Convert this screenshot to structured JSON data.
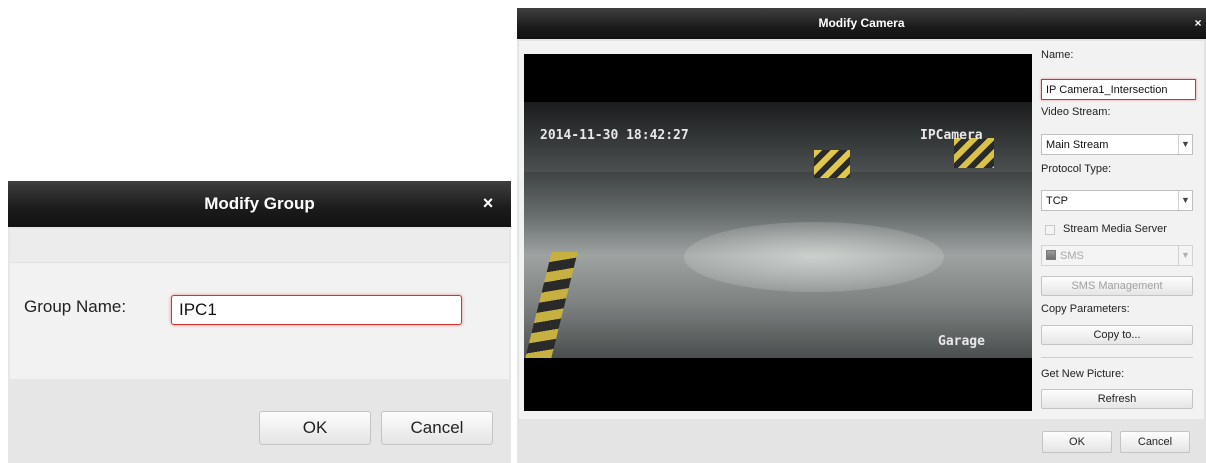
{
  "group_dialog": {
    "title": "Modify Group",
    "close_glyph": "×",
    "group_name_label": "Group Name:",
    "group_name_value": "IPC1",
    "ok_label": "OK",
    "cancel_label": "Cancel"
  },
  "camera_dialog": {
    "title": "Modify Camera",
    "close_glyph": "×",
    "preview": {
      "timestamp": "2014-11-30 18:42:27",
      "camera_osd": "IPCamera",
      "location_osd": "Garage"
    },
    "name_label": "Name:",
    "name_value": "IP Camera1_Intersection",
    "video_stream_label": "Video Stream:",
    "video_stream_value": "Main Stream",
    "protocol_type_label": "Protocol Type:",
    "protocol_type_value": "TCP",
    "stream_media_server_label": "Stream Media Server",
    "stream_media_server_checked": false,
    "sms_value": "SMS",
    "sms_management_label": "SMS Management",
    "copy_parameters_label": "Copy Parameters:",
    "copy_to_label": "Copy to...",
    "get_new_picture_label": "Get New Picture:",
    "refresh_label": "Refresh",
    "ok_label": "OK",
    "cancel_label": "Cancel"
  },
  "icons": {
    "close": "close-icon",
    "dropdown": "chevron-down-icon",
    "sms": "server-icon",
    "checkbox": "checkbox-icon"
  },
  "colors": {
    "title_bar": "#1b1b1b",
    "focus_border": "#d9302c",
    "dialog_bg": "#e6e6e6"
  }
}
